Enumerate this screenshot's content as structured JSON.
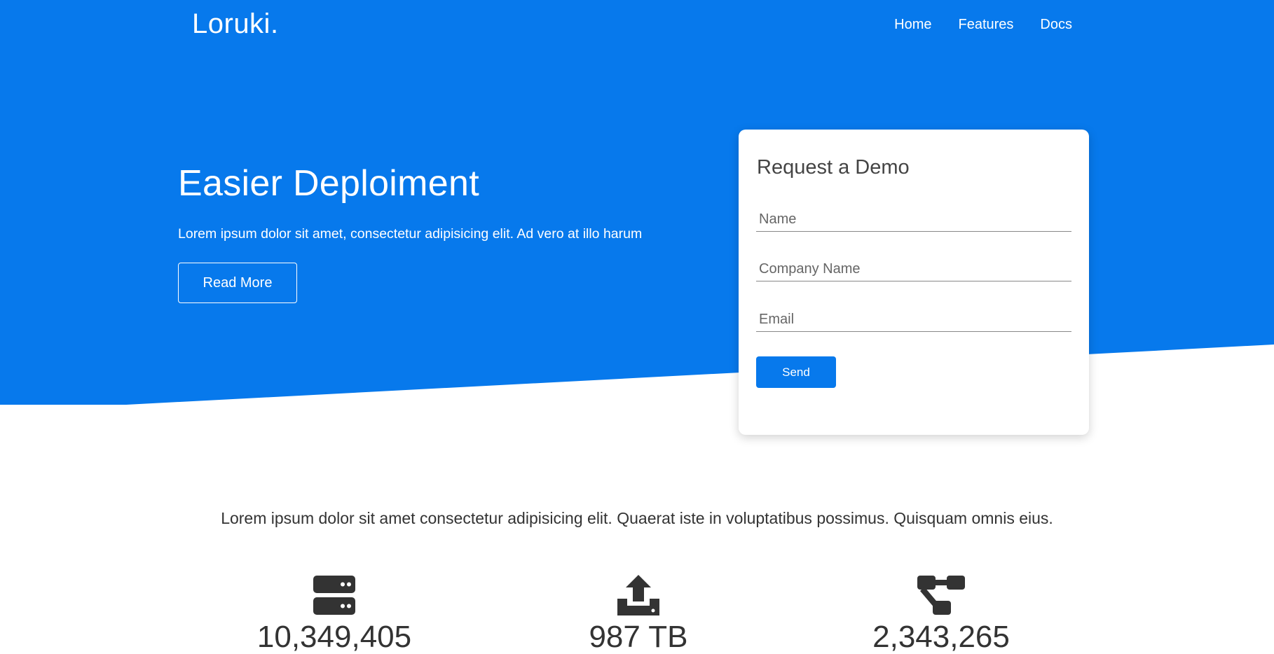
{
  "brand": {
    "logo": "Loruki."
  },
  "nav": {
    "items": [
      "Home",
      "Features",
      "Docs"
    ]
  },
  "hero": {
    "title": "Easier Deploiment",
    "subtitle": "Lorem ipsum dolor sit amet, consectetur adipisicing elit. Ad vero at illo harum",
    "cta_label": "Read More"
  },
  "demo_form": {
    "title": "Request a Demo",
    "name_placeholder": "Name",
    "company_placeholder": "Company Name",
    "email_placeholder": "Email",
    "send_label": "Send"
  },
  "stats": {
    "intro": "Lorem ipsum dolor sit amet consectetur adipisicing elit. Quaerat iste in voluptatibus possimus. Quisquam omnis eius.",
    "items": [
      {
        "icon": "server-icon",
        "value": "10,349,405"
      },
      {
        "icon": "upload-icon",
        "value": "987 TB"
      },
      {
        "icon": "network-icon",
        "value": "2,343,265"
      }
    ]
  },
  "colors": {
    "brand_blue": "#0779ec",
    "white": "#ffffff",
    "text": "#333333"
  }
}
